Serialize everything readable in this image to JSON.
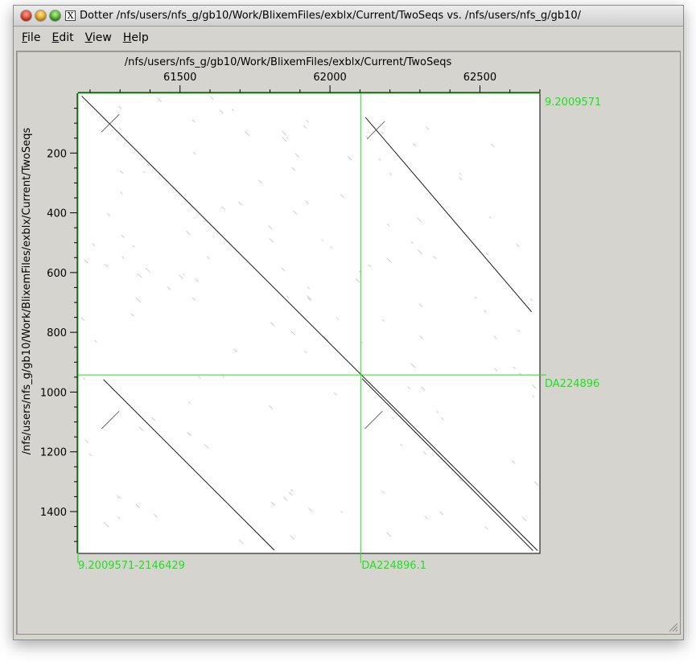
{
  "window": {
    "title": "Dotter /nfs/users/nfs_g/gb10/Work/BlixemFiles/exblx/Current/TwoSeqs vs. /nfs/users/nfs_g/gb10/",
    "x11_glyph": "X"
  },
  "menu": {
    "file": {
      "first": "F",
      "rest": "ile"
    },
    "edit": {
      "first": "E",
      "rest": "dit"
    },
    "view": {
      "first": "V",
      "rest": "iew"
    },
    "help": {
      "first": "H",
      "rest": "elp"
    }
  },
  "plot": {
    "horizontal_sequence": "/nfs/users/nfs_g/gb10/Work/BlixemFiles/exblx/Current/TwoSeqs",
    "vertical_sequence": "/nfs/users/nfs_g/gb10/Work/BlixemFiles/exblx/Current/TwoSeqs",
    "x_range": [
      61160,
      62700
    ],
    "y_range": [
      0,
      1540
    ],
    "x_ticks": [
      61500,
      62000,
      62500
    ],
    "y_ticks": [
      200,
      400,
      600,
      800,
      1000,
      1200,
      1400
    ],
    "crosshair_color": "#20e020",
    "green_labels": {
      "top_right": "9.2009571",
      "middle_right": "DA224896",
      "bottom_left": "9.2009571-2146429",
      "bottom_middle": "DA224896.1"
    }
  }
}
